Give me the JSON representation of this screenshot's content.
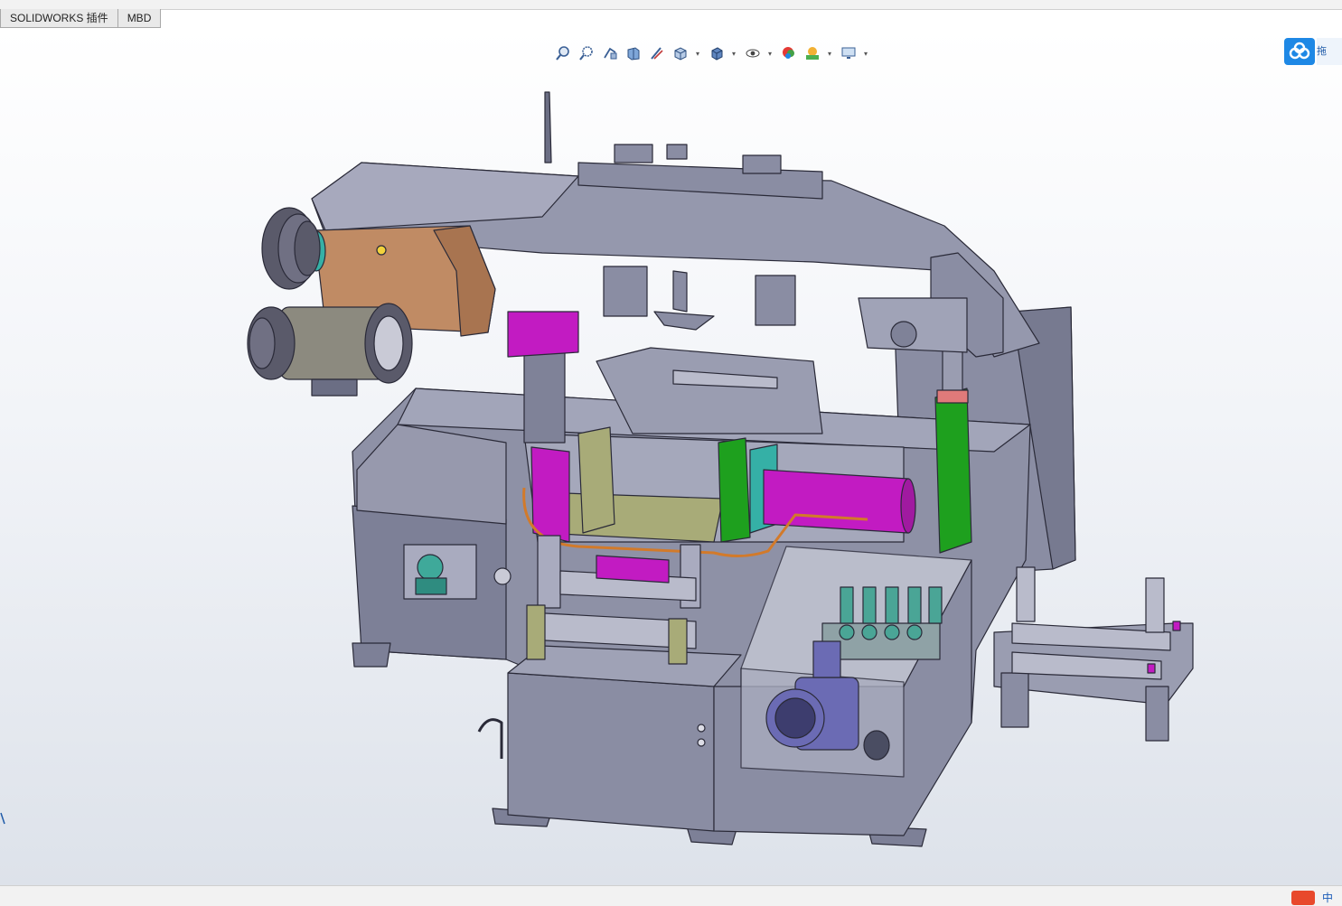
{
  "tabs": [
    "SOLIDWORKS 插件",
    "MBD"
  ],
  "heads_up_toolbar": [
    {
      "icon": "zoom-to-fit-icon",
      "dropdown": false
    },
    {
      "icon": "zoom-to-area-icon",
      "dropdown": false
    },
    {
      "icon": "previous-view-icon",
      "dropdown": false
    },
    {
      "icon": "section-view-icon",
      "dropdown": false
    },
    {
      "icon": "dynamic-annotation-icon",
      "dropdown": false
    },
    {
      "icon": "view-orientation-icon",
      "dropdown": true
    },
    {
      "icon": "display-style-icon",
      "dropdown": true
    },
    {
      "icon": "hide-show-items-icon",
      "dropdown": true
    },
    {
      "icon": "edit-appearance-icon",
      "dropdown": false
    },
    {
      "icon": "apply-scene-icon",
      "dropdown": true
    },
    {
      "icon": "view-settings-icon",
      "dropdown": true
    }
  ],
  "side_panel": {
    "label": "拖",
    "icon": "cloud-icon"
  },
  "status": {
    "ime_label": "中",
    "ime_icon": "sogou-ime-icon"
  },
  "colors": {
    "machine_body": "#8a8da3",
    "machine_edge": "#2a2a38",
    "gearbox": "#c08b64",
    "cylinder_magenta": "#c21bc2",
    "bracket_green": "#1ea01e",
    "vise_olive": "#a8ab78",
    "vise_cyan": "#35b0a6",
    "motor_dark": "#5a5a6a",
    "pump_purple": "#6b6bb4",
    "valve_teal": "#4aa596"
  }
}
